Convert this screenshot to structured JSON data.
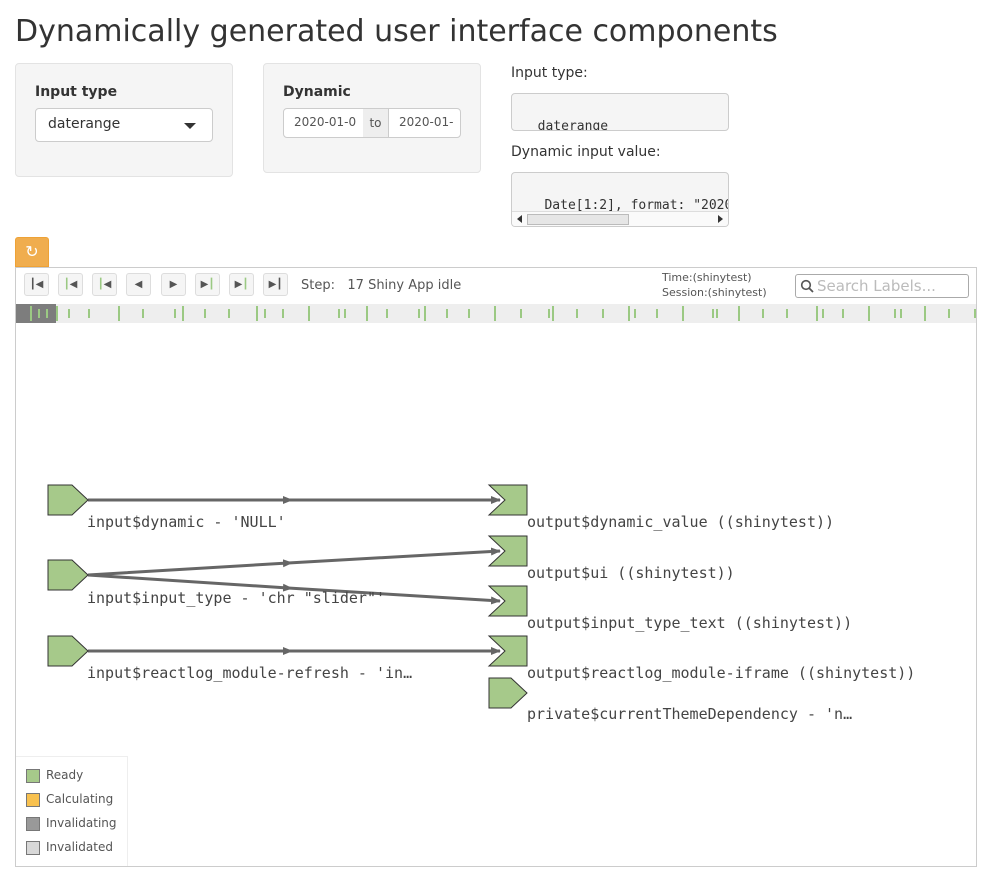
{
  "page_title": "Dynamically generated user interface components",
  "input_type_panel": {
    "label": "Input type",
    "selected": "daterange"
  },
  "dynamic_panel": {
    "label": "Dynamic",
    "start_date": "2020-01-0",
    "separator": "to",
    "end_date": "2020-01-"
  },
  "output_panel": {
    "input_type_label": "Input type:",
    "input_type_value": "daterange",
    "dynamic_value_label": "Dynamic input value:",
    "dynamic_value_text": " Date[1:2], format: \"2020-0"
  },
  "reactlog": {
    "refresh_icon": "refresh-icon",
    "toolbar": {
      "step_label": "Step:",
      "step_value": "17 Shiny App idle",
      "time_label": "Time:(shinytest)",
      "session_label": "Session:(shinytest)",
      "search_placeholder": "Search Labels..."
    },
    "inputs": [
      {
        "label": "input$dynamic - 'NULL'"
      },
      {
        "label": "input$input_type - 'chr \"slider\"'"
      },
      {
        "label": "input$reactlog_module-refresh - 'in…"
      }
    ],
    "outputs": [
      {
        "label": "output$dynamic_value ((shinytest))"
      },
      {
        "label": "output$ui ((shinytest))"
      },
      {
        "label": "output$input_type_text ((shinytest))"
      },
      {
        "label": "output$reactlog_module-iframe ((shinytest))"
      },
      {
        "label": "private$currentThemeDependency - 'n…"
      }
    ],
    "legend": [
      {
        "label": "Ready",
        "color": "#a6c98a"
      },
      {
        "label": "Calculating",
        "color": "#f8c14f"
      },
      {
        "label": "Invalidating",
        "color": "#999999"
      },
      {
        "label": "Invalidated",
        "color": "#d8d8d8"
      }
    ],
    "colors": {
      "node_ready": "#a6c98a",
      "edge": "#666666",
      "timeline_tick": "#9bc983"
    }
  }
}
